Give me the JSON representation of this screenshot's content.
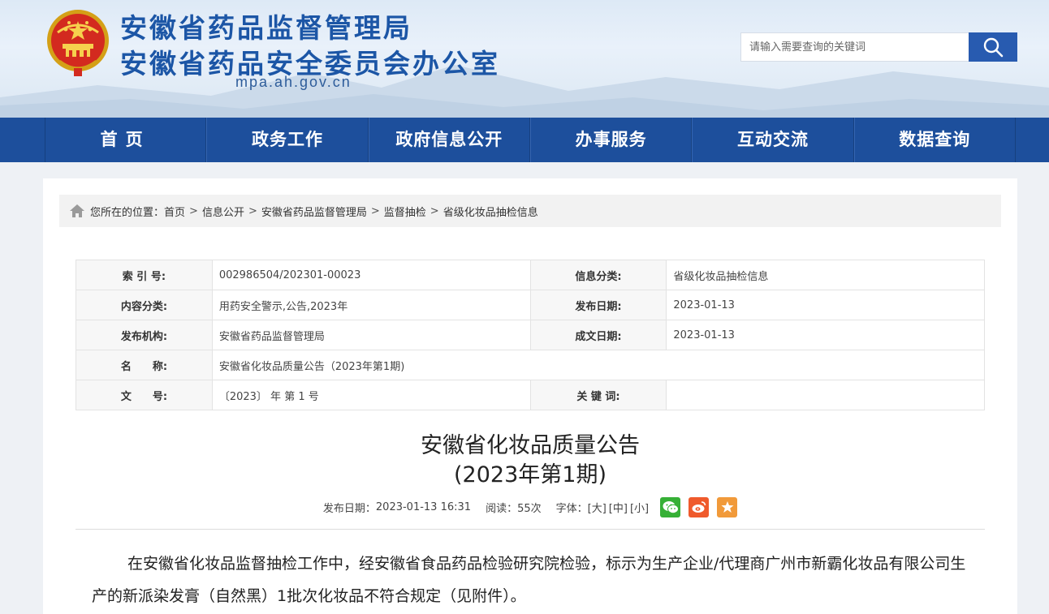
{
  "header": {
    "title_line1": "安徽省药品监督管理局",
    "title_line2": "安徽省药品安全委员会办公室",
    "domain": "mpa.ah.gov.cn",
    "search_placeholder": "请输入需要查询的关键词"
  },
  "nav": {
    "items": [
      "首页",
      "政务工作",
      "政府信息公开",
      "办事服务",
      "互动交流",
      "数据查询"
    ]
  },
  "breadcrumb": {
    "prefix": "您所在的位置：",
    "items": [
      "首页",
      "信息公开",
      "安徽省药品监督管理局",
      "监督抽检",
      "省级化妆品抽检信息"
    ],
    "separator": ">"
  },
  "meta": {
    "index_label": "索 引 号:",
    "index_value": "002986504/202301-00023",
    "category_label": "信息分类:",
    "category_value": "省级化妆品抽检信息",
    "content_type_label": "内容分类:",
    "content_type_value": "用药安全警示,公告,2023年",
    "publish_date_label": "发布日期:",
    "publish_date_value": "2023-01-13",
    "issuer_label": "发布机构:",
    "issuer_value": "安徽省药品监督管理局",
    "written_date_label": "成文日期:",
    "written_date_value": "2023-01-13",
    "name_label": "名　　称:",
    "name_value": "安徽省化妆品质量公告（2023年第1期)",
    "doc_no_label": "文　　号:",
    "doc_no_value": "〔2023〕 年 第 1 号",
    "keywords_label": "关 键 词:",
    "keywords_value": ""
  },
  "article": {
    "title_line1": "安徽省化妆品质量公告",
    "title_line2": "(2023年第1期)",
    "publish_label": "发布日期：",
    "publish_time": "2023-01-13 16:31",
    "reads_label": "阅读：",
    "reads_value": "55次",
    "font_label": "字体：",
    "font_large": "[大]",
    "font_medium": "[中]",
    "font_small": "[小]",
    "body": "在安徽省化妆品监督抽检工作中，经安徽省食品药品检验研究院检验，标示为生产企业/代理商广州市新霸化妆品有限公司生产的新派染发膏（自然黑）1批次化妆品不符合规定（见附件）。"
  },
  "colors": {
    "nav_bg": "#1d4f9c",
    "title_blue": "#1c56a6",
    "wechat": "#36b036",
    "weibo": "#ef5a2c",
    "favorite": "#f19a3a"
  },
  "icons": {
    "search": "search-icon",
    "home": "home-icon",
    "wechat": "wechat-icon",
    "weibo": "weibo-icon",
    "favorite": "star-icon"
  }
}
